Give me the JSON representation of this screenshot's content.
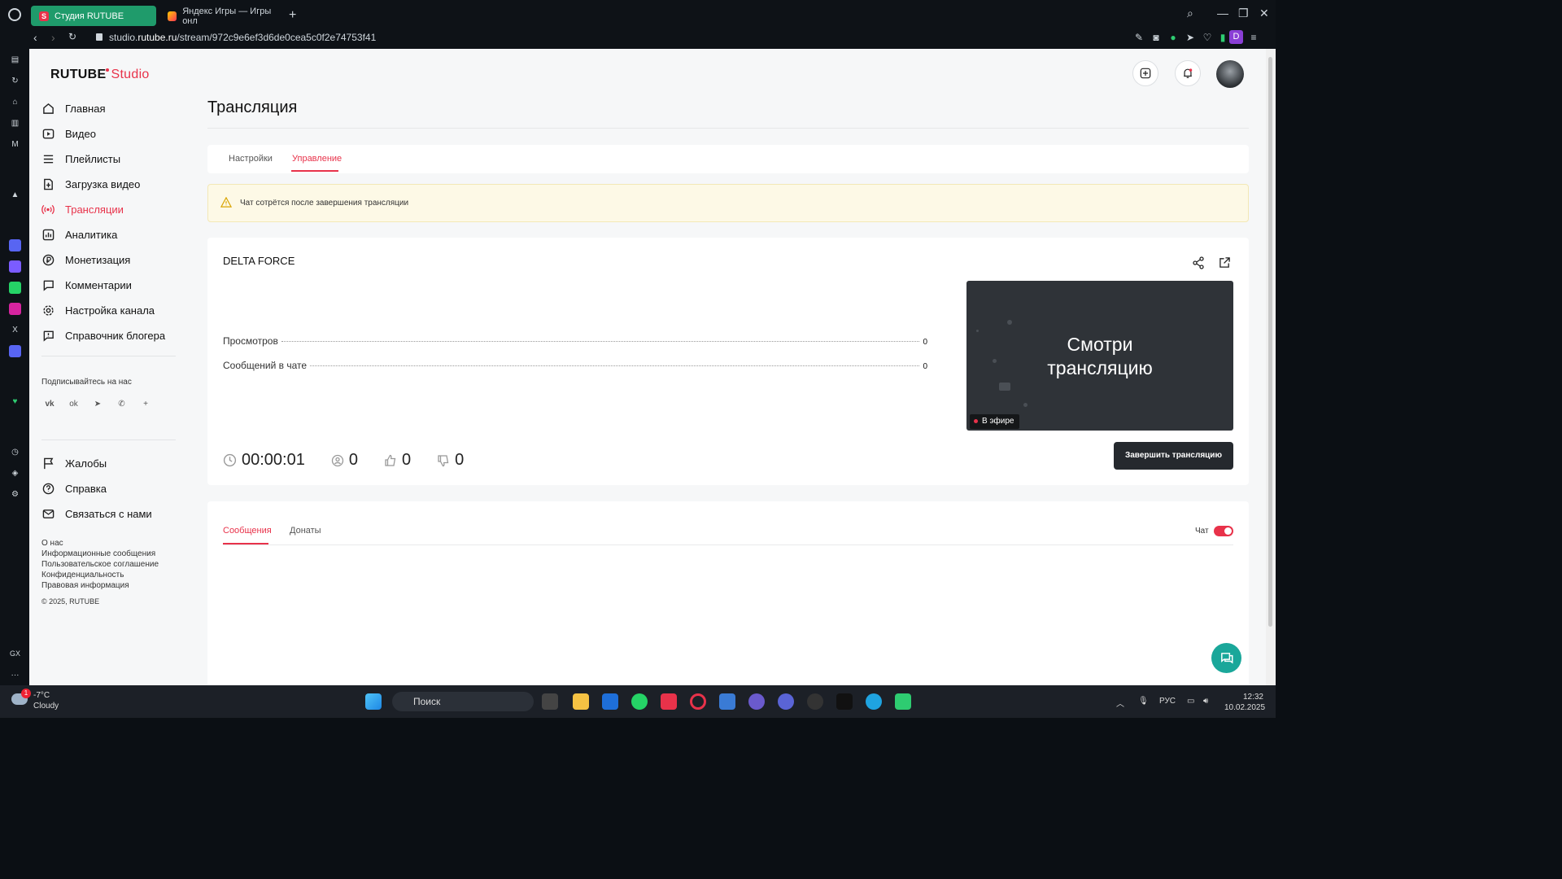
{
  "browser": {
    "tabs": [
      {
        "title": "Студия RUTUBE",
        "favicon": "S"
      },
      {
        "title": "Яндекс Игры — Игры онл"
      }
    ],
    "url_prefix": "studio.",
    "url_domain": "rutube.ru",
    "url_path": "/stream/972c9e6ef3d6de0cea5c0f2e74753f41",
    "profile_letter": "D"
  },
  "brand": {
    "name": "RUTUBE",
    "studio": "Studio",
    "accent": "#e8324a"
  },
  "sidebar": {
    "items": [
      {
        "label": "Главная",
        "icon": "home-icon"
      },
      {
        "label": "Видео",
        "icon": "video-icon"
      },
      {
        "label": "Плейлисты",
        "icon": "list-icon"
      },
      {
        "label": "Загрузка видео",
        "icon": "upload-icon"
      },
      {
        "label": "Трансляции",
        "icon": "broadcast-icon",
        "active": true
      },
      {
        "label": "Аналитика",
        "icon": "analytics-icon"
      },
      {
        "label": "Монетизация",
        "icon": "ruble-icon"
      },
      {
        "label": "Комментарии",
        "icon": "comment-icon"
      },
      {
        "label": "Настройка канала",
        "icon": "gear-icon"
      },
      {
        "label": "Справочник блогера",
        "icon": "info-icon"
      }
    ],
    "subscribe_label": "Подписывайтесь на нас",
    "socials": [
      "vk-icon",
      "ok-icon",
      "telegram-icon",
      "viber-icon",
      "more-icon"
    ],
    "secondary": [
      {
        "label": "Жалобы",
        "icon": "flag-icon"
      },
      {
        "label": "Справка",
        "icon": "help-icon"
      },
      {
        "label": "Связаться с нами",
        "icon": "mail-icon"
      }
    ],
    "footer_links": [
      "О нас",
      "Информационные сообщения",
      "Пользовательское соглашение",
      "Конфиденциальность",
      "Правовая информация"
    ],
    "copyright": "© 2025, RUTUBE"
  },
  "main": {
    "title": "Трансляция",
    "tabs": [
      {
        "label": "Настройки"
      },
      {
        "label": "Управление",
        "active": true
      }
    ],
    "warning": "Чат сотрётся после завершения трансляции",
    "stream": {
      "name": "DELTA FORCE",
      "stats": [
        {
          "label": "Просмотров",
          "value": "0"
        },
        {
          "label": "Сообщений в чате",
          "value": "0"
        }
      ],
      "duration": "00:00:01",
      "viewers": "0",
      "likes": "0",
      "dislikes": "0",
      "preview_line1": "Смотри",
      "preview_line2": "трансляцию",
      "live_label": "В эфире",
      "end_button": "Завершить трансляцию"
    },
    "chat": {
      "tabs": [
        {
          "label": "Сообщения",
          "active": true
        },
        {
          "label": "Донаты"
        }
      ],
      "toggle_label": "Чат",
      "toggle_on": true
    }
  },
  "taskbar": {
    "temperature": "-7°C",
    "weather": "Cloudy",
    "weather_badge": "1",
    "search_placeholder": "Поиск",
    "language": "РУС",
    "time": "12:32",
    "date": "10.02.2025"
  }
}
